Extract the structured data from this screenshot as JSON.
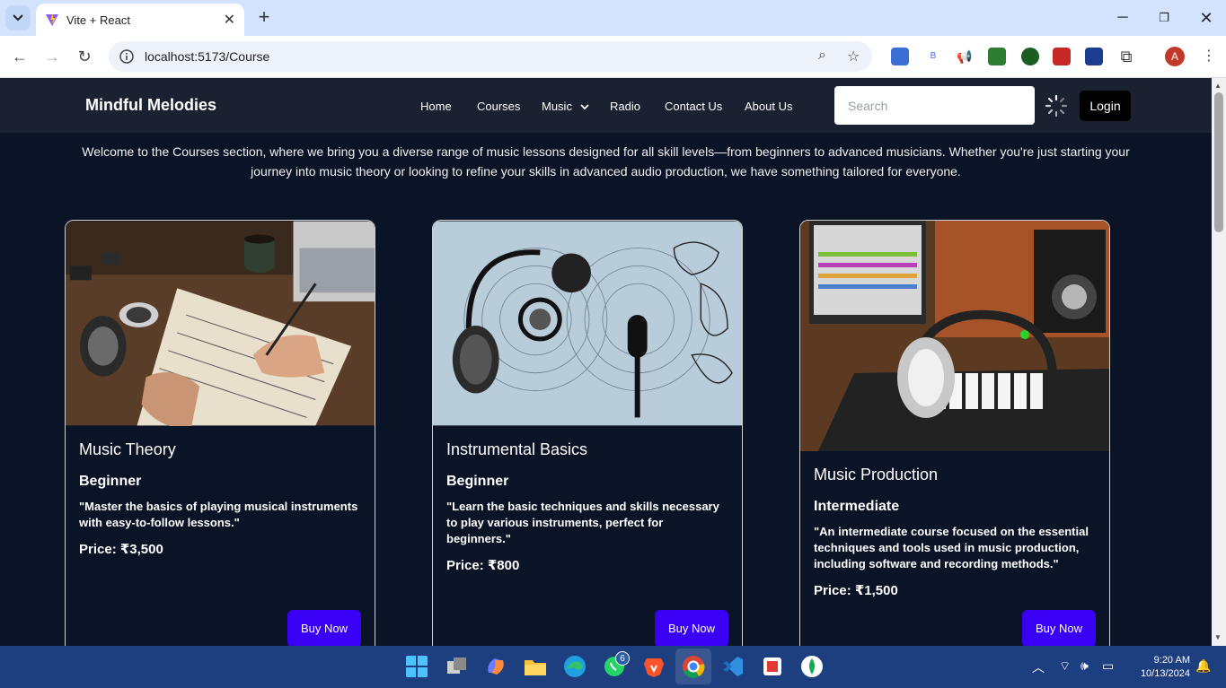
{
  "browser": {
    "tab_title": "Vite + React",
    "url": "localhost:5173/Course"
  },
  "site": {
    "brand": "Mindful Melodies",
    "nav": [
      "Home",
      "Courses",
      "Music",
      "Radio",
      "Contact Us",
      "About Us"
    ],
    "search_placeholder": "Search",
    "login_label": "Login",
    "intro": "Welcome to the Courses section, where we bring you a diverse range of music lessons designed for all skill levels—from beginners to advanced musicians. Whether you're just starting your journey into music theory or looking to refine your skills in advanced audio production, we have something tailored for everyone."
  },
  "courses": [
    {
      "title": "Music Theory",
      "level": "Beginner",
      "description": "\"Master the basics of playing musical instruments with easy-to-follow lessons.\"",
      "price": "Price: ₹3,500",
      "button": "Buy Now"
    },
    {
      "title": "Instrumental Basics",
      "level": "Beginner",
      "description": "\"Learn the basic techniques and skills necessary to play various instruments, perfect for beginners.\"",
      "price": "Price: ₹800",
      "button": "Buy Now"
    },
    {
      "title": "Music Production",
      "level": "Intermediate",
      "description": "\"An intermediate course focused on the essential techniques and tools used in music production, including software and recording methods.\"",
      "price": "Price: ₹1,500",
      "button": "Buy Now"
    }
  ],
  "taskbar": {
    "whatsapp_badge": "6",
    "time": "9:20 AM",
    "date": "10/13/2024"
  },
  "profile_initial": "A",
  "colors": {
    "page_bg": "#0b1326",
    "navbar_bg": "#1a2232",
    "buy_button": "#3a00f5",
    "taskbar": "#1d3f80"
  }
}
